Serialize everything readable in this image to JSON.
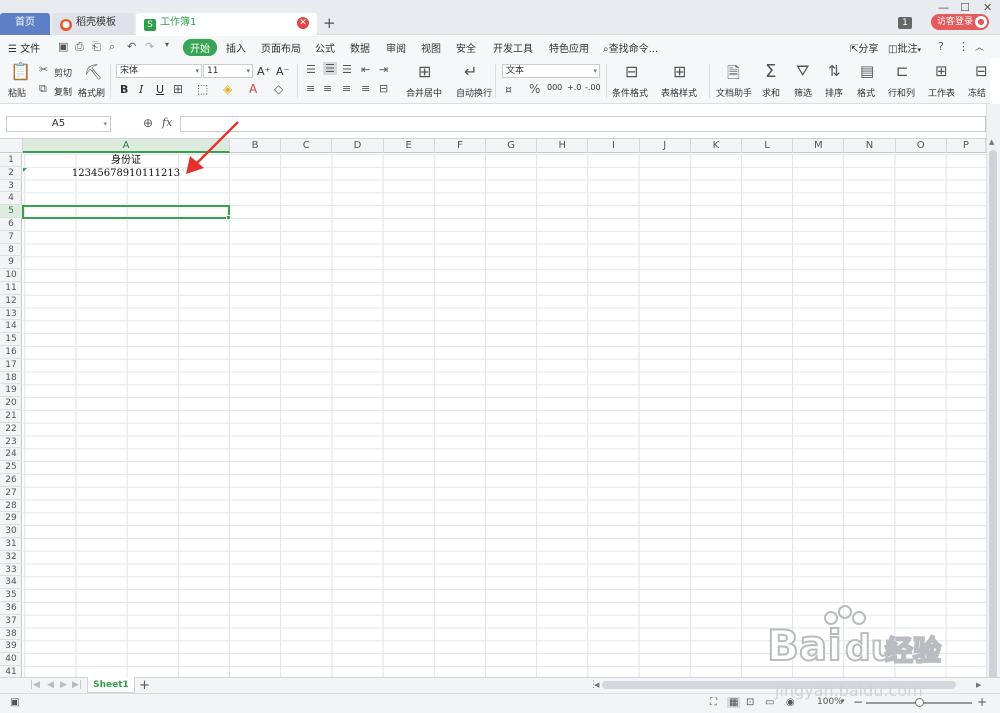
{
  "tabs": {
    "home": "首页",
    "template": "稻壳模板",
    "workbook": "工作簿1",
    "workbook_icon_letter": "S"
  },
  "titlebar": {
    "window_count": "1",
    "login": "访客登录"
  },
  "menu": {
    "file": "文件",
    "items": [
      "开始",
      "插入",
      "页面布局",
      "公式",
      "数据",
      "审阅",
      "视图",
      "安全",
      "开发工具",
      "特色应用"
    ],
    "search": "查找命令...",
    "share": "分享",
    "comment": "批注"
  },
  "ribbon": {
    "paste": "粘贴",
    "cut": "剪切",
    "copy": "复制",
    "format_painter": "格式刷",
    "font_name": "宋体",
    "font_size": "11",
    "bold": "B",
    "italic": "I",
    "underline": "U",
    "merge_center": "合并居中",
    "wrap_text": "自动换行",
    "number_format": "文本",
    "conditional_format": "条件格式",
    "table_style": "表格样式",
    "doc_assistant": "文档助手",
    "sum": "求和",
    "filter": "筛选",
    "sort": "排序",
    "format": "格式",
    "row_col": "行和列",
    "worksheet": "工作表",
    "freeze": "冻结"
  },
  "formula_bar": {
    "name_box": "A5",
    "fx": "fx",
    "value": ""
  },
  "columns": [
    "A",
    "B",
    "C",
    "D",
    "E",
    "F",
    "G",
    "H",
    "I",
    "J",
    "K",
    "L",
    "M",
    "N",
    "O",
    "P"
  ],
  "rows": [
    "1",
    "2",
    "3",
    "4",
    "5",
    "6",
    "7",
    "8",
    "9",
    "10",
    "11",
    "12",
    "13",
    "14",
    "15",
    "16",
    "17",
    "18",
    "19",
    "20",
    "21",
    "22",
    "23",
    "24",
    "25",
    "26",
    "27",
    "28",
    "29",
    "30",
    "31",
    "32",
    "33",
    "34",
    "35",
    "36",
    "37",
    "38",
    "39",
    "40",
    "41"
  ],
  "cells": {
    "A1": "身份证",
    "A2": "12345678910111213"
  },
  "selected": {
    "column": "A",
    "row": "5"
  },
  "sheets": [
    "Sheet1"
  ],
  "status": {
    "zoom": "100%"
  },
  "watermark": {
    "brand": "Bai",
    "suffix": "du",
    "jingyan": "经验",
    "url": "jingyan.baidu.com"
  },
  "colors": {
    "accent": "#37a04b",
    "home_tab": "#5d7fc8",
    "login": "#e55a5a",
    "arrow": "#e5322d"
  }
}
